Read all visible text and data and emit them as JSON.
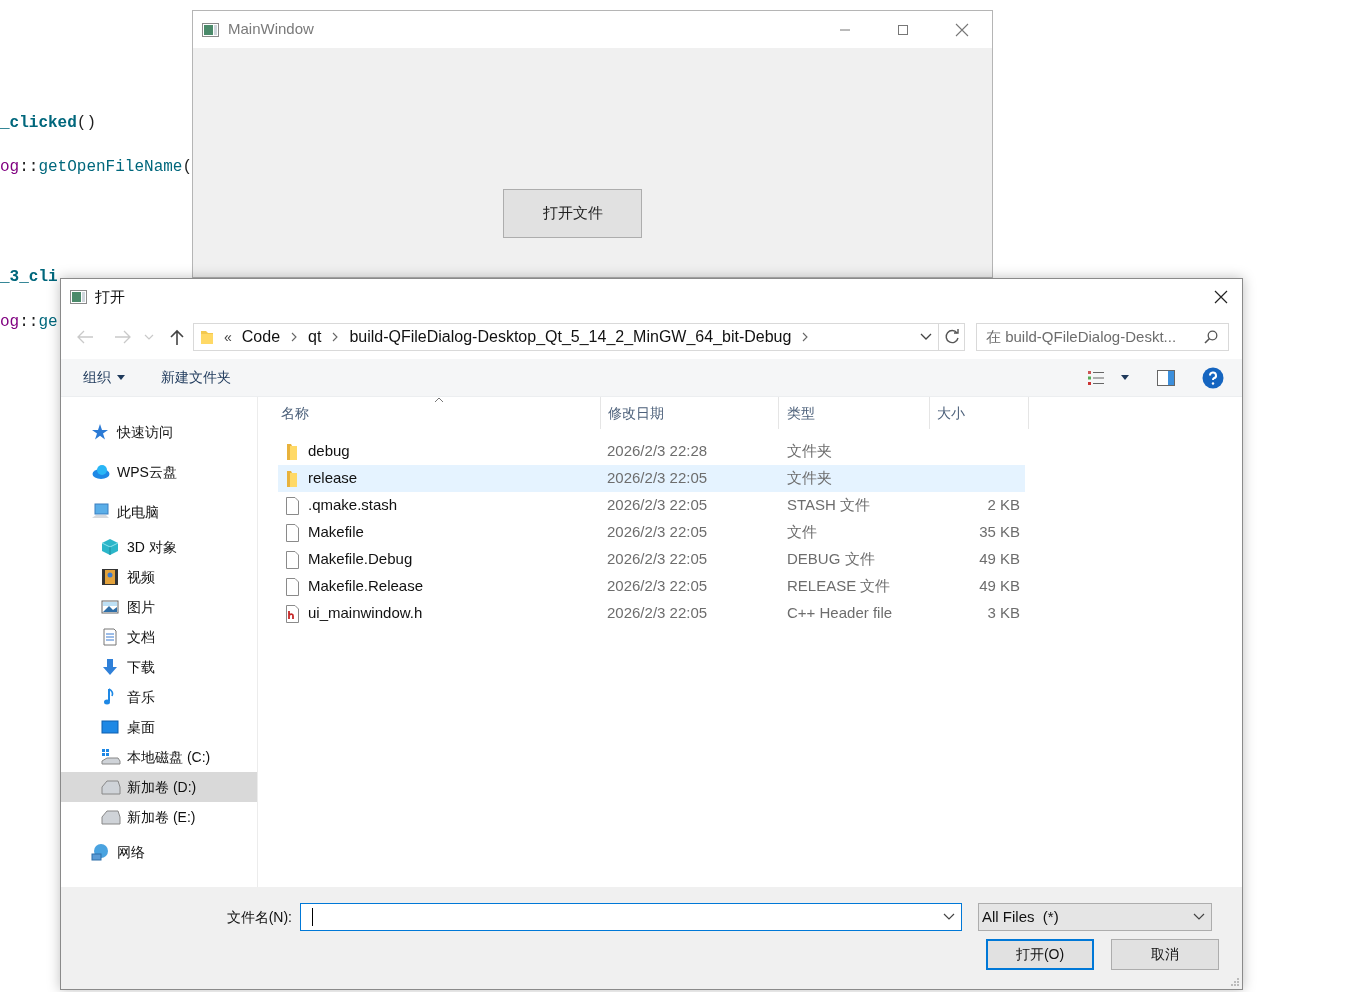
{
  "code_editor": {
    "lines": [
      {
        "segments": [
          {
            "text": "_clicked",
            "kind": "function_bold"
          },
          {
            "text": "()",
            "kind": "plain"
          }
        ]
      },
      {
        "segments": [
          {
            "text": "og",
            "kind": "namespace"
          },
          {
            "text": "::",
            "kind": "plain"
          },
          {
            "text": "getOpenFileName",
            "kind": "function"
          },
          {
            "text": "(",
            "kind": "plain"
          }
        ]
      },
      {
        "segments": [
          {
            "text": "_3_cli",
            "kind": "function_bold"
          }
        ]
      },
      {
        "segments": [
          {
            "text": "og",
            "kind": "namespace"
          },
          {
            "text": "::",
            "kind": "plain"
          },
          {
            "text": "ge",
            "kind": "function"
          }
        ]
      }
    ]
  },
  "main_window": {
    "title": "MainWindow",
    "button": "打开文件"
  },
  "dialog": {
    "title": "打开",
    "nav_buttons": [
      {
        "kind": "back",
        "disabled": true
      },
      {
        "kind": "forward",
        "disabled": true
      },
      {
        "kind": "recent",
        "disabled": true
      },
      {
        "kind": "up",
        "disabled": false
      }
    ],
    "address_bar": {
      "overflow": "«",
      "crumbs": [
        "Code",
        "qt",
        "build-QFileDialog-Desktop_Qt_5_14_2_MinGW_64_bit-Debug"
      ]
    },
    "search": {
      "placeholder": "在 build-QFileDialog-Deskt..."
    },
    "toolbar": {
      "organize": "组织",
      "new_folder": "新建文件夹"
    },
    "sidebar": {
      "items": [
        {
          "label": "快速访问",
          "selected": false
        },
        {
          "label": "WPS云盘",
          "selected": false
        },
        {
          "label": "此电脑",
          "selected": false,
          "children": [
            {
              "label": "3D 对象",
              "selected": false
            },
            {
              "label": "视频",
              "selected": false
            },
            {
              "label": "图片",
              "selected": false
            },
            {
              "label": "文档",
              "selected": false
            },
            {
              "label": "下载",
              "selected": false
            },
            {
              "label": "音乐",
              "selected": false
            },
            {
              "label": "桌面",
              "selected": false
            },
            {
              "label": "本地磁盘 (C:)",
              "selected": false
            },
            {
              "label": "新加卷 (D:)",
              "selected": true
            },
            {
              "label": "新加卷 (E:)",
              "selected": false
            }
          ]
        },
        {
          "label": "网络",
          "selected": false
        }
      ]
    },
    "file_list": {
      "columns": [
        {
          "label": "名称",
          "sorted": true
        },
        {
          "label": "修改日期",
          "sorted": false
        },
        {
          "label": "类型",
          "sorted": false
        },
        {
          "label": "大小",
          "sorted": false
        }
      ],
      "rows": [
        {
          "kind": "folder",
          "name": "debug",
          "modified": "2026/2/3 22:28",
          "type": "文件夹",
          "selected": false
        },
        {
          "kind": "folder",
          "name": "release",
          "modified": "2026/2/3 22:05",
          "type": "文件夹",
          "selected": true
        },
        {
          "kind": "file",
          "name": ".qmake.stash",
          "modified": "2026/2/3 22:05",
          "type": "STASH 文件",
          "size": "2 KB",
          "selected": false
        },
        {
          "kind": "file",
          "name": "Makefile",
          "modified": "2026/2/3 22:05",
          "type": "文件",
          "size": "35 KB",
          "selected": false
        },
        {
          "kind": "file",
          "name": "Makefile.Debug",
          "modified": "2026/2/3 22:05",
          "type": "DEBUG 文件",
          "size": "49 KB",
          "selected": false
        },
        {
          "kind": "file",
          "name": "Makefile.Release",
          "modified": "2026/2/3 22:05",
          "type": "RELEASE 文件",
          "size": "49 KB",
          "selected": false
        },
        {
          "kind": "header",
          "name": "ui_mainwindow.h",
          "modified": "2026/2/3 22:05",
          "type": "C++ Header file",
          "size": "3 KB",
          "selected": false
        }
      ]
    },
    "file_name": {
      "label": "文件名(N):"
    },
    "file_type": {
      "value": "All Files  (*)"
    },
    "buttons": [
      {
        "label": "打开(O)",
        "default": true
      },
      {
        "label": "取消",
        "default": false
      }
    ]
  }
}
